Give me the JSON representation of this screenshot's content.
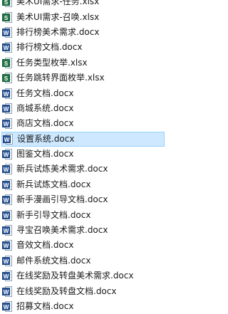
{
  "files": [
    {
      "name": "美术UI需求-任务.xlsx",
      "type": "excel",
      "badge": "S",
      "selected": false
    },
    {
      "name": "美术UI需求-召唤.xlsx",
      "type": "excel",
      "badge": "S",
      "selected": false
    },
    {
      "name": "排行榜美术需求.docx",
      "type": "word",
      "badge": "W",
      "selected": false
    },
    {
      "name": "排行榜文档.docx",
      "type": "word",
      "badge": "W",
      "selected": false
    },
    {
      "name": "任务类型枚举.xlsx",
      "type": "excel",
      "badge": "S",
      "selected": false
    },
    {
      "name": "任务跳转界面枚举.xlsx",
      "type": "excel",
      "badge": "S",
      "selected": false
    },
    {
      "name": "任务文档.docx",
      "type": "word",
      "badge": "W",
      "selected": false
    },
    {
      "name": "商城系统.docx",
      "type": "word",
      "badge": "W",
      "selected": false
    },
    {
      "name": "商店文档.docx",
      "type": "word",
      "badge": "W",
      "selected": false
    },
    {
      "name": "设置系统.docx",
      "type": "word",
      "badge": "W",
      "selected": true
    },
    {
      "name": "图鉴文档.docx",
      "type": "word",
      "badge": "W",
      "selected": false
    },
    {
      "name": "新兵试炼美术需求.docx",
      "type": "word",
      "badge": "W",
      "selected": false
    },
    {
      "name": "新兵试炼文档.docx",
      "type": "word",
      "badge": "W",
      "selected": false
    },
    {
      "name": "新手漫画引导文档.docx",
      "type": "word",
      "badge": "W",
      "selected": false
    },
    {
      "name": "新手引导文档.docx",
      "type": "word",
      "badge": "W",
      "selected": false
    },
    {
      "name": "寻宝召唤美术需求.docx",
      "type": "word",
      "badge": "W",
      "selected": false
    },
    {
      "name": "音效文档.docx",
      "type": "word",
      "badge": "W",
      "selected": false
    },
    {
      "name": "邮件系统文档.docx",
      "type": "word",
      "badge": "W",
      "selected": false
    },
    {
      "name": "在线奖励及转盘美术需求.docx",
      "type": "word",
      "badge": "W",
      "selected": false
    },
    {
      "name": "在线奖励及转盘文档.docx",
      "type": "word",
      "badge": "W",
      "selected": false
    },
    {
      "name": "招募文档.docx",
      "type": "word",
      "badge": "W",
      "selected": false
    }
  ],
  "colors": {
    "selection_bg": "#cde8ff",
    "selection_border": "#99d1ff",
    "word_blue": "#2b579a",
    "excel_green": "#217346"
  }
}
